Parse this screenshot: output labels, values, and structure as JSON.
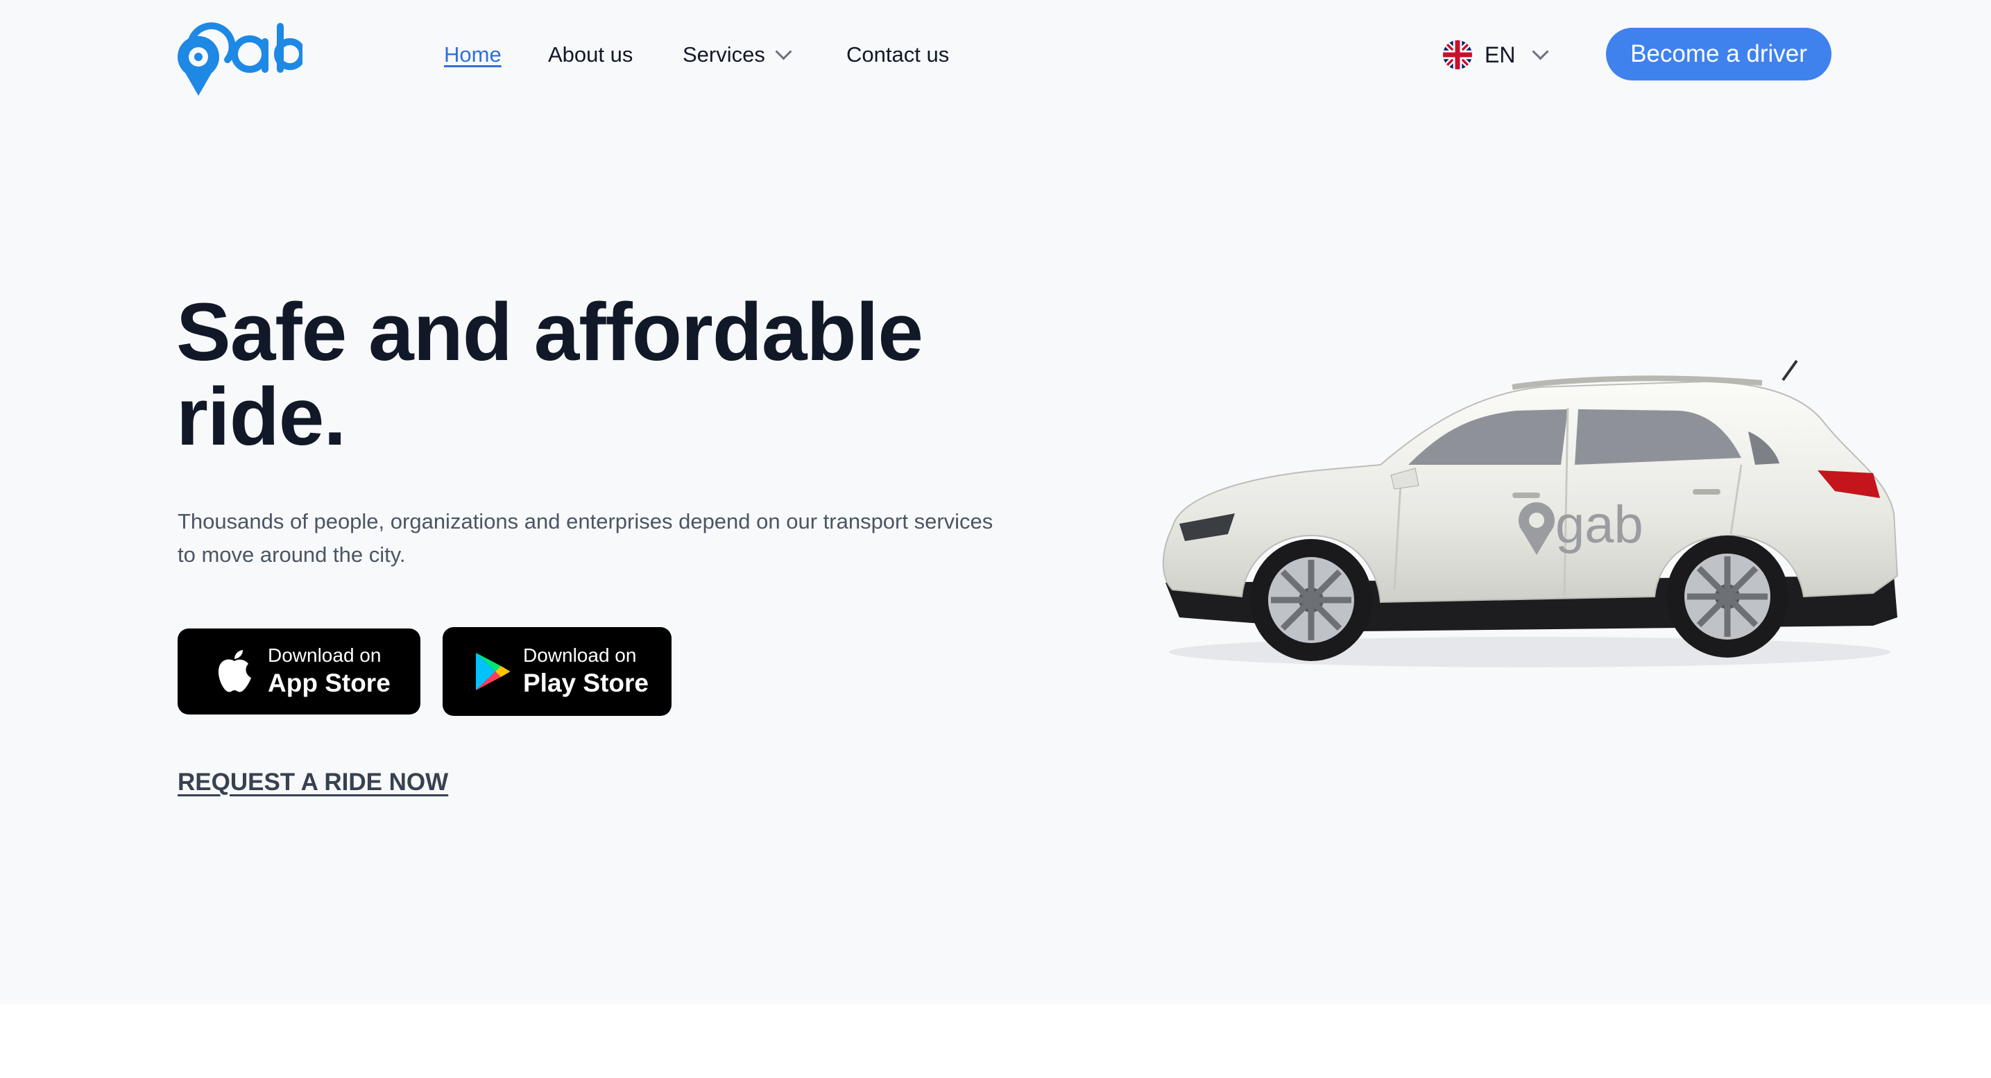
{
  "brand": {
    "logo_text": "gab",
    "accent_color": "#3f82ee",
    "logo_color": "#1e88e5"
  },
  "nav": {
    "home": "Home",
    "about": "About us",
    "services": "Services",
    "contact": "Contact us",
    "active": "Home"
  },
  "language": {
    "code": "EN",
    "flag_icon": "uk-flag-icon"
  },
  "header_cta": "Become a driver",
  "hero": {
    "headline": "Safe and affordable ride.",
    "subtext": "Thousands of people, organizations and enterprises depend on our transport services to move around the city.",
    "app_store": {
      "small": "Download on",
      "big": "App Store",
      "icon": "apple-icon"
    },
    "play_store": {
      "small": "Download on",
      "big": "Play Store",
      "icon": "google-play-icon"
    },
    "request_link": "REQUEST A RIDE NOW",
    "image": "white-suv-with-gab-logo",
    "car_logo_text": "gab"
  },
  "colors": {
    "hero_background": "#f8f9fb",
    "headline": "#111827",
    "store_button": "#000000"
  }
}
